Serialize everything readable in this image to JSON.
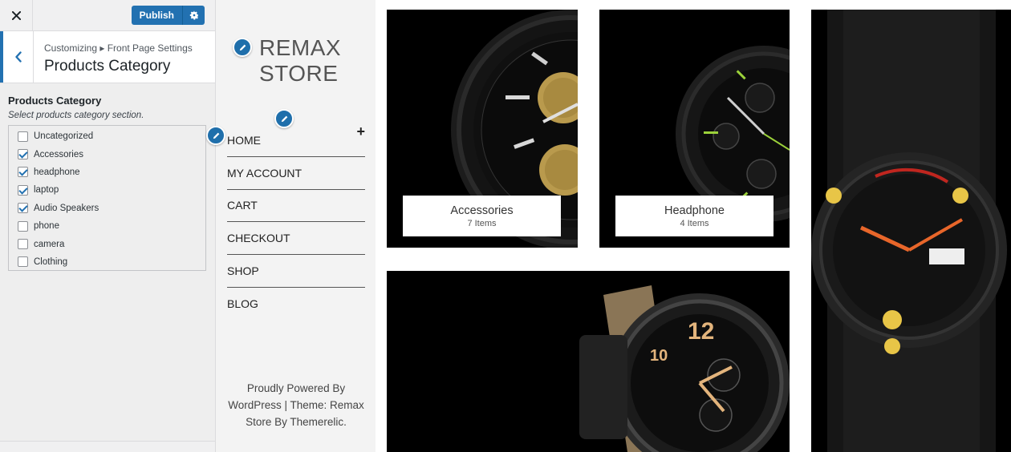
{
  "customizer": {
    "publish_label": "Publish",
    "breadcrumb": "Customizing ▸ Front Page Settings",
    "section_title": "Products Category",
    "control_title": "Products Category",
    "control_description": "Select products category section.",
    "categories": [
      {
        "label": "Uncategorized",
        "checked": false
      },
      {
        "label": "Accessories",
        "checked": true
      },
      {
        "label": "headphone",
        "checked": true
      },
      {
        "label": "laptop",
        "checked": true
      },
      {
        "label": "Audio Speakers",
        "checked": true
      },
      {
        "label": "phone",
        "checked": false
      },
      {
        "label": "camera",
        "checked": false
      },
      {
        "label": "Clothing",
        "checked": false
      }
    ],
    "accent_color": "#2271b1"
  },
  "site": {
    "logo_line1": "REMAX",
    "logo_line2": "STORE",
    "menu": [
      "HOME",
      "MY ACCOUNT",
      "CART",
      "CHECKOUT",
      "SHOP",
      "BLOG"
    ],
    "footer_line1": "Proudly Powered By",
    "footer_line2": "WordPress | Theme: Remax",
    "footer_line3": "Store By Themerelic."
  },
  "products": [
    {
      "name": "Accessories",
      "count": "7 Items"
    },
    {
      "name": "Headphone",
      "count": "4 Items"
    }
  ]
}
